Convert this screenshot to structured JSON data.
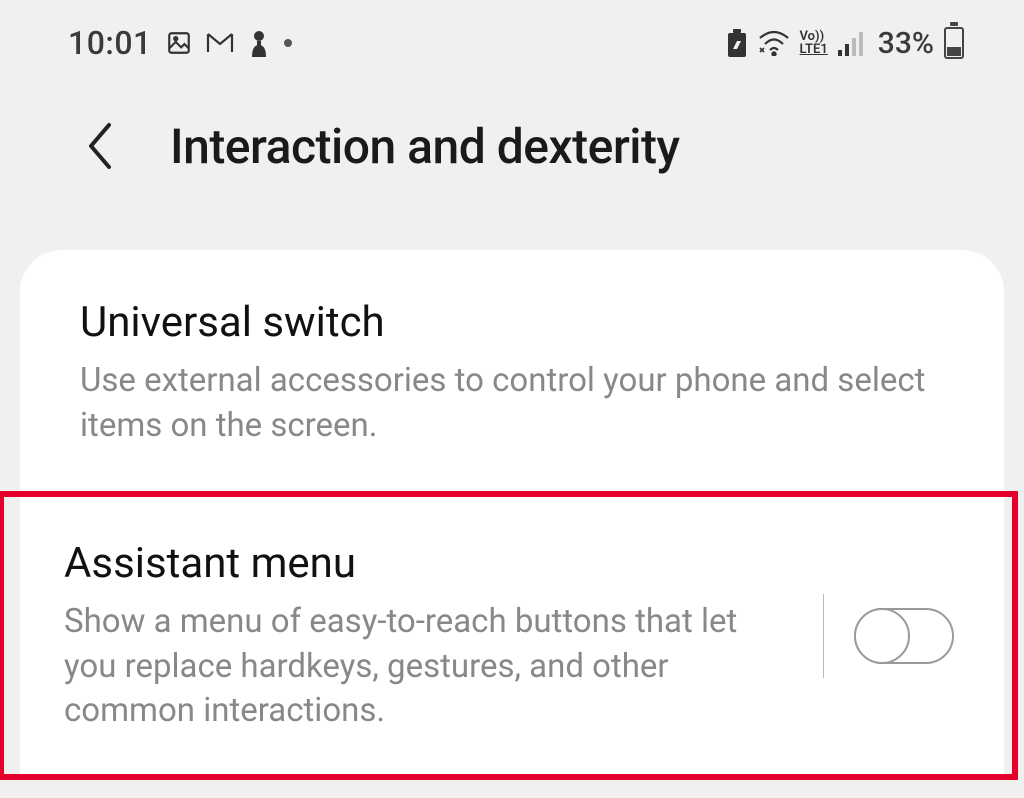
{
  "status": {
    "time": "10:01",
    "lte_line1": "Vo))",
    "lte_line2": "LTE1",
    "battery_pct": "33%"
  },
  "header": {
    "title": "Interaction and dexterity"
  },
  "settings": {
    "universal_switch": {
      "title": "Universal switch",
      "desc": "Use external accessories to control your phone and select items on the screen."
    },
    "assistant_menu": {
      "title": "Assistant menu",
      "desc": "Show a menu of easy-to-reach buttons that let you replace hardkeys, gestures, and other common interactions.",
      "toggle_on": false
    }
  }
}
